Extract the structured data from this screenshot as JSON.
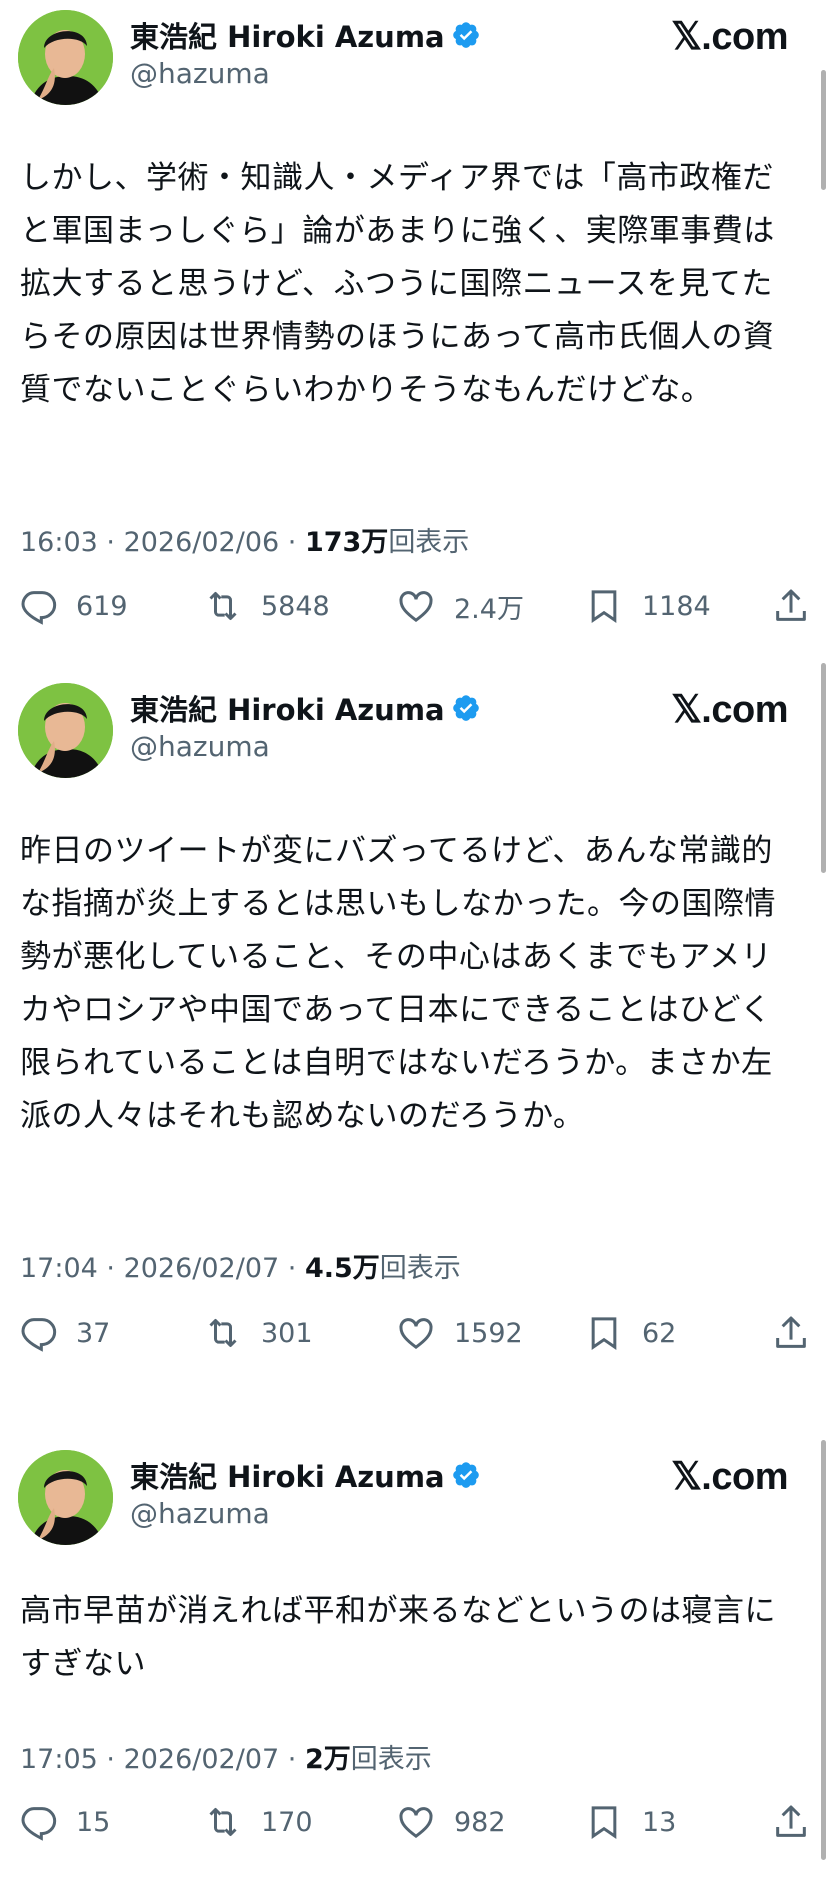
{
  "tweets": [
    {
      "author": {
        "name": "東浩紀 Hiroki Azuma",
        "handle": "@hazuma"
      },
      "source": "𝕏.com",
      "text": "しかし、学術・知識人・メディア界では「高市政権だと軍国まっしぐら」論があまりに強く、実際軍事費は拡大すると思うけど、ふつうに国際ニュースを見てたらその原因は世界情勢のほうにあって高市氏個人の資質でないことぐらいわかりそうなもんだけどな。",
      "meta": {
        "time": "16:03",
        "date": "2026/02/06",
        "views": "173万",
        "views_suffix": "回表示"
      },
      "stats": {
        "replies": "619",
        "reposts": "5848",
        "likes": "2.4万",
        "bookmarks": "1184"
      }
    },
    {
      "author": {
        "name": "東浩紀 Hiroki Azuma",
        "handle": "@hazuma"
      },
      "source": "𝕏.com",
      "text": "昨日のツイートが変にバズってるけど、あんな常識的な指摘が炎上するとは思いもしなかった。今の国際情勢が悪化していること、その中心はあくまでもアメリカやロシアや中国であって日本にできることはひどく限られていることは自明ではないだろうか。まさか左派の人々はそれも認めないのだろうか。",
      "meta": {
        "time": "17:04",
        "date": "2026/02/07",
        "views": "4.5万",
        "views_suffix": "回表示"
      },
      "stats": {
        "replies": "37",
        "reposts": "301",
        "likes": "1592",
        "bookmarks": "62"
      }
    },
    {
      "author": {
        "name": "東浩紀 Hiroki Azuma",
        "handle": "@hazuma"
      },
      "source": "𝕏.com",
      "text": "高市早苗が消えれば平和が来るなどというのは寝言にすぎない",
      "meta": {
        "time": "17:05",
        "date": "2026/02/07",
        "views": "2万",
        "views_suffix": "回表示"
      },
      "stats": {
        "replies": "15",
        "reposts": "170",
        "likes": "982",
        "bookmarks": "13"
      }
    }
  ],
  "icons": {
    "verified": "verified-badge-icon",
    "reply": "reply-bubble-icon",
    "repost": "repost-arrows-icon",
    "like": "heart-icon",
    "bookmark": "bookmark-icon",
    "share": "share-upload-icon"
  },
  "colors": {
    "verified": "#1d9bf0",
    "avatar_bg": "#7ec242",
    "muted": "#536471",
    "text": "#0f1419"
  }
}
